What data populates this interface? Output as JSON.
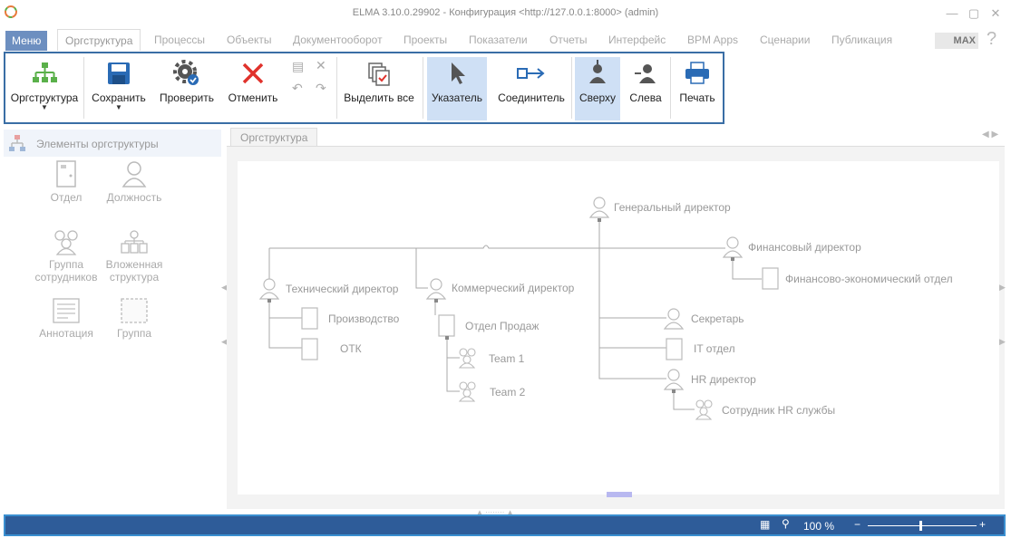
{
  "window": {
    "title": "ELMA 3.10.0.29902 - Конфигурация <http://127.0.0.1:8000> (admin)"
  },
  "tabs": [
    {
      "label": "Меню"
    },
    {
      "label": "Оргструктура"
    },
    {
      "label": "Процессы"
    },
    {
      "label": "Объекты"
    },
    {
      "label": "Документооборот"
    },
    {
      "label": "Проекты"
    },
    {
      "label": "Показатели"
    },
    {
      "label": "Отчеты"
    },
    {
      "label": "Интерфейс"
    },
    {
      "label": "BPM Apps"
    },
    {
      "label": "Сценарии"
    },
    {
      "label": "Публикация"
    }
  ],
  "edition_badge": "MAX",
  "toolbar": {
    "orgstructure": "Оргструктура",
    "save": "Сохранить",
    "check": "Проверить",
    "cancel": "Отменить",
    "select_all": "Выделить все",
    "pointer": "Указатель",
    "connector": "Соединитель",
    "top": "Сверху",
    "left": "Слева",
    "print": "Печать"
  },
  "left_panel": {
    "title": "Элементы оргструктуры",
    "items": [
      {
        "label": "Отдел"
      },
      {
        "label": "Должность"
      },
      {
        "label": "Группа\nсотрудников"
      },
      {
        "label": "Вложенная\nструктура"
      },
      {
        "label": "Аннотация"
      },
      {
        "label": "Группа"
      }
    ]
  },
  "doc_tab": "Оргструктура",
  "org_nodes": {
    "ceo": "Генеральный директор",
    "cfo": "Финансовый директор",
    "fin_dept": "Финансово-экономический отдел",
    "cto": "Технический директор",
    "production": "Производство",
    "otk": "ОТК",
    "cco": "Коммерческий директор",
    "sales": "Отдел Продаж",
    "team1": "Team 1",
    "team2": "Team 2",
    "secretary": "Секретарь",
    "it": "IT отдел",
    "hr_director": "HR директор",
    "hr_staff": "Сотрудник HR службы"
  },
  "status": {
    "zoom": "100 %"
  }
}
